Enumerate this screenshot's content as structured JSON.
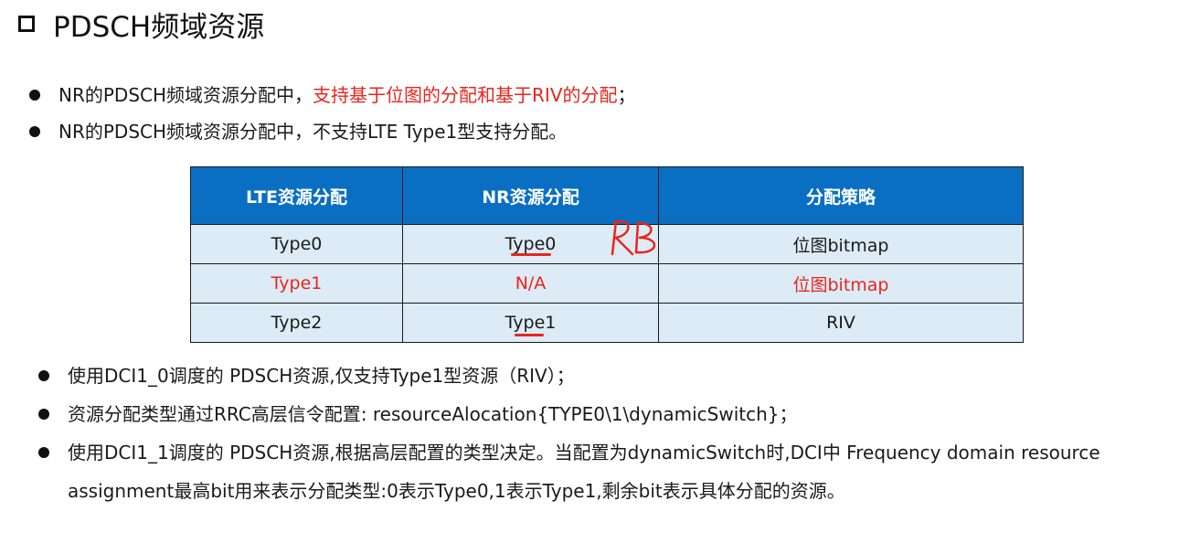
{
  "title": "PDSCH频域资源",
  "top_bullets": [
    {
      "normal": "NR的PDSCH频域资源分配中，",
      "highlight": "支持基于位图的分配和基于RIV的分配",
      "tail": "；"
    },
    {
      "normal": "NR的PDSCH频域资源分配中，不支持LTE Type1型支持分配。",
      "highlight": "",
      "tail": ""
    }
  ],
  "table": {
    "headers": [
      "LTE资源分配",
      "NR资源分配",
      "分配策略"
    ],
    "rows": [
      [
        "Type0",
        "Type0",
        "位图bitmap"
      ],
      [
        "Type1",
        "N/A",
        "位图bitmap"
      ],
      [
        "Type2",
        "Type1",
        "RIV"
      ]
    ],
    "header_color": "#0a6fc2",
    "cell_color": "#dcebf6",
    "highlight_color": "#e8261d"
  },
  "annotation_text": "RB",
  "bottom_bullets": [
    "使用DCI1_0调度的 PDSCH资源,仅支持Type1型资源（RIV）；",
    "资源分配类型通过RRC高层信令配置: resourceAlocation{TYPE0\\1\\dynamicSwitch}；",
    "使用DCI1_1调度的 PDSCH资源,根据高层配置的类型决定。当配置为dynamicSwitch时,DCI中 Frequency domain resource assignment最高bit用来表示分配类型:0表示Type0,1表示Type1,剩余bit表示具体分配的资源。"
  ]
}
